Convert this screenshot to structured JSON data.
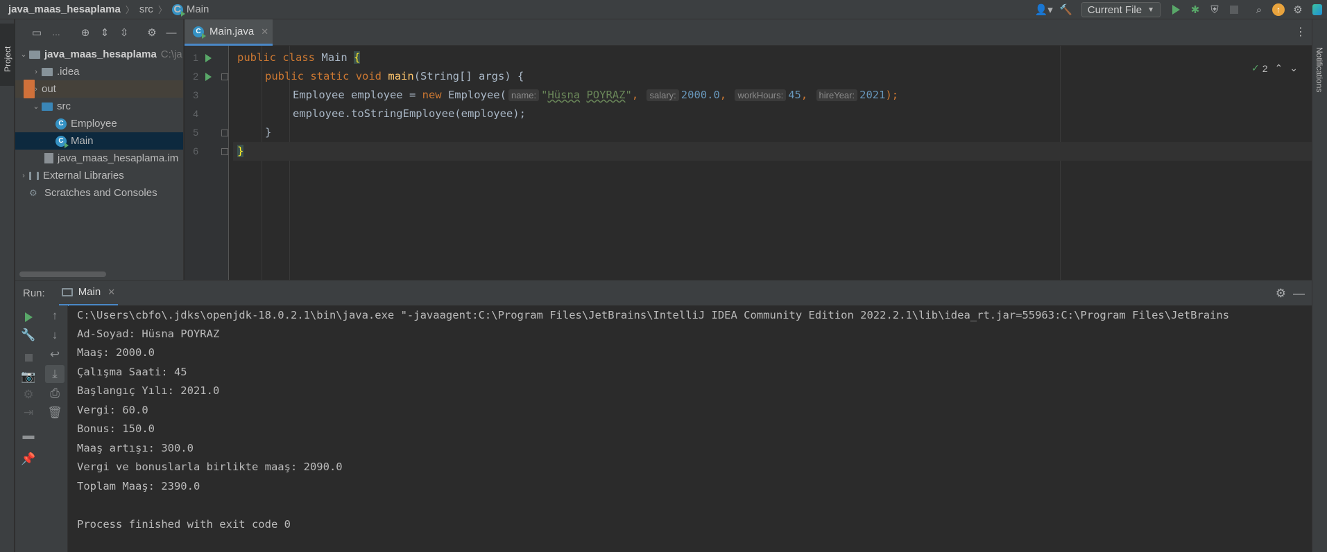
{
  "breadcrumb": {
    "project": "java_maas_hesaplama",
    "folder": "src",
    "file": "Main"
  },
  "toolbar": {
    "run_config": "Current File"
  },
  "left_stripe": {
    "label": "Project"
  },
  "right_stripe": {
    "label": "Notifications"
  },
  "project_tree": {
    "root": {
      "name": "java_maas_hesaplama",
      "path": "C:\\ja"
    },
    "items": [
      {
        "label": ".idea"
      },
      {
        "label": "out"
      },
      {
        "label": "src"
      },
      {
        "label": "Employee"
      },
      {
        "label": "Main"
      },
      {
        "label": "java_maas_hesaplama.im"
      },
      {
        "label": "External Libraries"
      },
      {
        "label": "Scratches and Consoles"
      }
    ]
  },
  "editor": {
    "tab_label": "Main.java",
    "line_numbers": [
      "1",
      "2",
      "3",
      "4",
      "5",
      "6"
    ],
    "inspection_count": "2",
    "code": {
      "l1_kw1": "public",
      "l1_kw2": "class",
      "l1_name": "Main",
      "l1_brace": "{",
      "l2_kw1": "public",
      "l2_kw2": "static",
      "l2_kw3": "void",
      "l2_fn": "main",
      "l2_rest": "(String[] args) {",
      "l3_a": "Employee employee = ",
      "l3_new": "new",
      "l3_b": " Employee(",
      "l3_hint_name": "name:",
      "l3_str_q1": "\"",
      "l3_str_a": "Hüsna",
      "l3_str_sp": " ",
      "l3_str_b": "POYRAZ",
      "l3_str_q2": "\"",
      "l3_comma1": ", ",
      "l3_hint_salary": "salary:",
      "l3_salary": "2000.0",
      "l3_comma2": ", ",
      "l3_hint_work": "workHours:",
      "l3_work": "45",
      "l3_comma3": ", ",
      "l3_hint_hire": "hireYear:",
      "l3_hire": "2021",
      "l3_end": ");",
      "l4": "employee.toStringEmployee(employee);",
      "l5": "}",
      "l6": "}"
    }
  },
  "run_panel": {
    "label": "Run:",
    "tab_label": "Main",
    "output": [
      "C:\\Users\\cbfo\\.jdks\\openjdk-18.0.2.1\\bin\\java.exe \"-javaagent:C:\\Program Files\\JetBrains\\IntelliJ IDEA Community Edition 2022.2.1\\lib\\idea_rt.jar=55963:C:\\Program Files\\JetBrains",
      "Ad-Soyad: Hüsna POYRAZ",
      "Maaş: 2000.0",
      "Çalışma Saati: 45",
      "Başlangıç Yılı: 2021.0",
      "Vergi: 60.0",
      "Bonus: 150.0",
      "Maaş artışı: 300.0",
      "Vergi ve bonuslarla birlikte maaş: 2090.0",
      "Toplam Maaş: 2390.0",
      "",
      "Process finished with exit code 0"
    ]
  }
}
